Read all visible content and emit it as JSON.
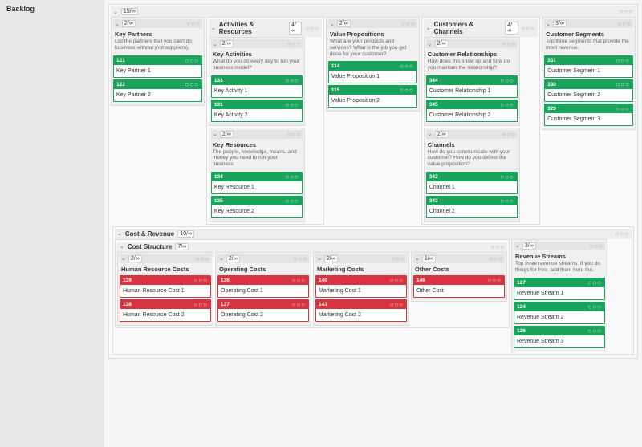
{
  "sidebar": {
    "title": "Backlog"
  },
  "topCount": "15/∞",
  "groups": {
    "activitiesResources": {
      "title": "Activities & Resources",
      "count": "4/∞"
    },
    "customersChannels": {
      "title": "Customers & Channels",
      "count": "4/∞"
    },
    "costRevenue": {
      "title": "Cost & Revenue",
      "count": "10/∞"
    },
    "costStructure": {
      "title": "Cost Structure",
      "count": "7/∞"
    }
  },
  "lists": {
    "keyPartners": {
      "count": "2/∞",
      "title": "Key Partners",
      "desc": "List the partners that you can't do business without (not suppliers).",
      "cards": [
        {
          "id": "121",
          "t": "Key Partner 1"
        },
        {
          "id": "122",
          "t": "Key Partner 2"
        }
      ]
    },
    "keyActivities": {
      "count": "2/∞",
      "title": "Key Activities",
      "desc": "What do you do every day to run your business model?",
      "cards": [
        {
          "id": "133",
          "t": "Key Activity 1"
        },
        {
          "id": "131",
          "t": "Key Activity 2"
        }
      ]
    },
    "keyResources": {
      "count": "2/∞",
      "title": "Key Resources",
      "desc": "The people, knowledge, means, and money you need to run your business.",
      "cards": [
        {
          "id": "134",
          "t": "Key Resource 1"
        },
        {
          "id": "135",
          "t": "Key Resource 2"
        }
      ]
    },
    "valueProps": {
      "count": "2/∞",
      "title": "Value Propositions",
      "desc": "What are your products and services? What is the job you get done for your customer?",
      "cards": [
        {
          "id": "114",
          "t": "Value Proposition 1"
        },
        {
          "id": "115",
          "t": "Value Proposition 2"
        }
      ]
    },
    "custRel": {
      "count": "2/∞",
      "title": "Customer Relationships",
      "desc": "How does this show up and how do you maintain the relationship?",
      "cards": [
        {
          "id": "344",
          "t": "Customer Relationship 1"
        },
        {
          "id": "345",
          "t": "Customer Relationship 2"
        }
      ]
    },
    "channels": {
      "count": "2/∞",
      "title": "Channels",
      "desc": "How do you communicate with your customer? How do you deliver the value proposition?",
      "cards": [
        {
          "id": "342",
          "t": "Channel 1"
        },
        {
          "id": "343",
          "t": "Channel 2"
        }
      ]
    },
    "custSeg": {
      "count": "3/∞",
      "title": "Customer Segments",
      "desc": "Top three segments that provide the most revenue.",
      "cards": [
        {
          "id": "331",
          "t": "Customer Segment 1"
        },
        {
          "id": "330",
          "t": "Customer Segment 2"
        },
        {
          "id": "329",
          "t": "Customer Segment 3"
        }
      ]
    },
    "hrCosts": {
      "count": "2/∞",
      "title": "Human Resource Costs",
      "cards": [
        {
          "id": "139",
          "t": "Human Resource Cost 1"
        },
        {
          "id": "138",
          "t": "Human Resource Cost 2"
        }
      ]
    },
    "opCosts": {
      "count": "2/∞",
      "title": "Operating Costs",
      "cards": [
        {
          "id": "136",
          "t": "Operating Cost 1"
        },
        {
          "id": "137",
          "t": "Operating Cost 2"
        }
      ]
    },
    "mkCosts": {
      "count": "2/∞",
      "title": "Marketing Costs",
      "cards": [
        {
          "id": "140",
          "t": "Marketing Cost 1"
        },
        {
          "id": "141",
          "t": "Marketing Cost 2"
        }
      ]
    },
    "otherCosts": {
      "count": "1/∞",
      "title": "Other Costs",
      "cards": [
        {
          "id": "146",
          "t": "Other Cost"
        }
      ]
    },
    "revStreams": {
      "count": "3/∞",
      "title": "Revenue Streams",
      "desc": "Top three revenue streams. If you do things for free, add them here too.",
      "cards": [
        {
          "id": "127",
          "t": "Revenue Stream 1"
        },
        {
          "id": "124",
          "t": "Revenue Stream 2"
        },
        {
          "id": "126",
          "t": "Revenue Stream 3"
        }
      ]
    }
  },
  "dots": "○○○"
}
